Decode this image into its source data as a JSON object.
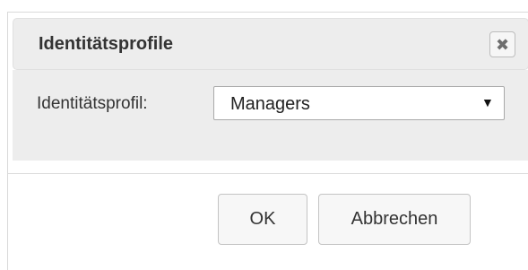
{
  "dialog": {
    "title": "Identitätsprofile",
    "close_icon": "close-icon"
  },
  "form": {
    "label": "Identitätsprofil:",
    "select_value": "Managers",
    "select_arrow": "▼"
  },
  "buttons": {
    "ok_label": "OK",
    "cancel_label": "Abbrechen"
  }
}
